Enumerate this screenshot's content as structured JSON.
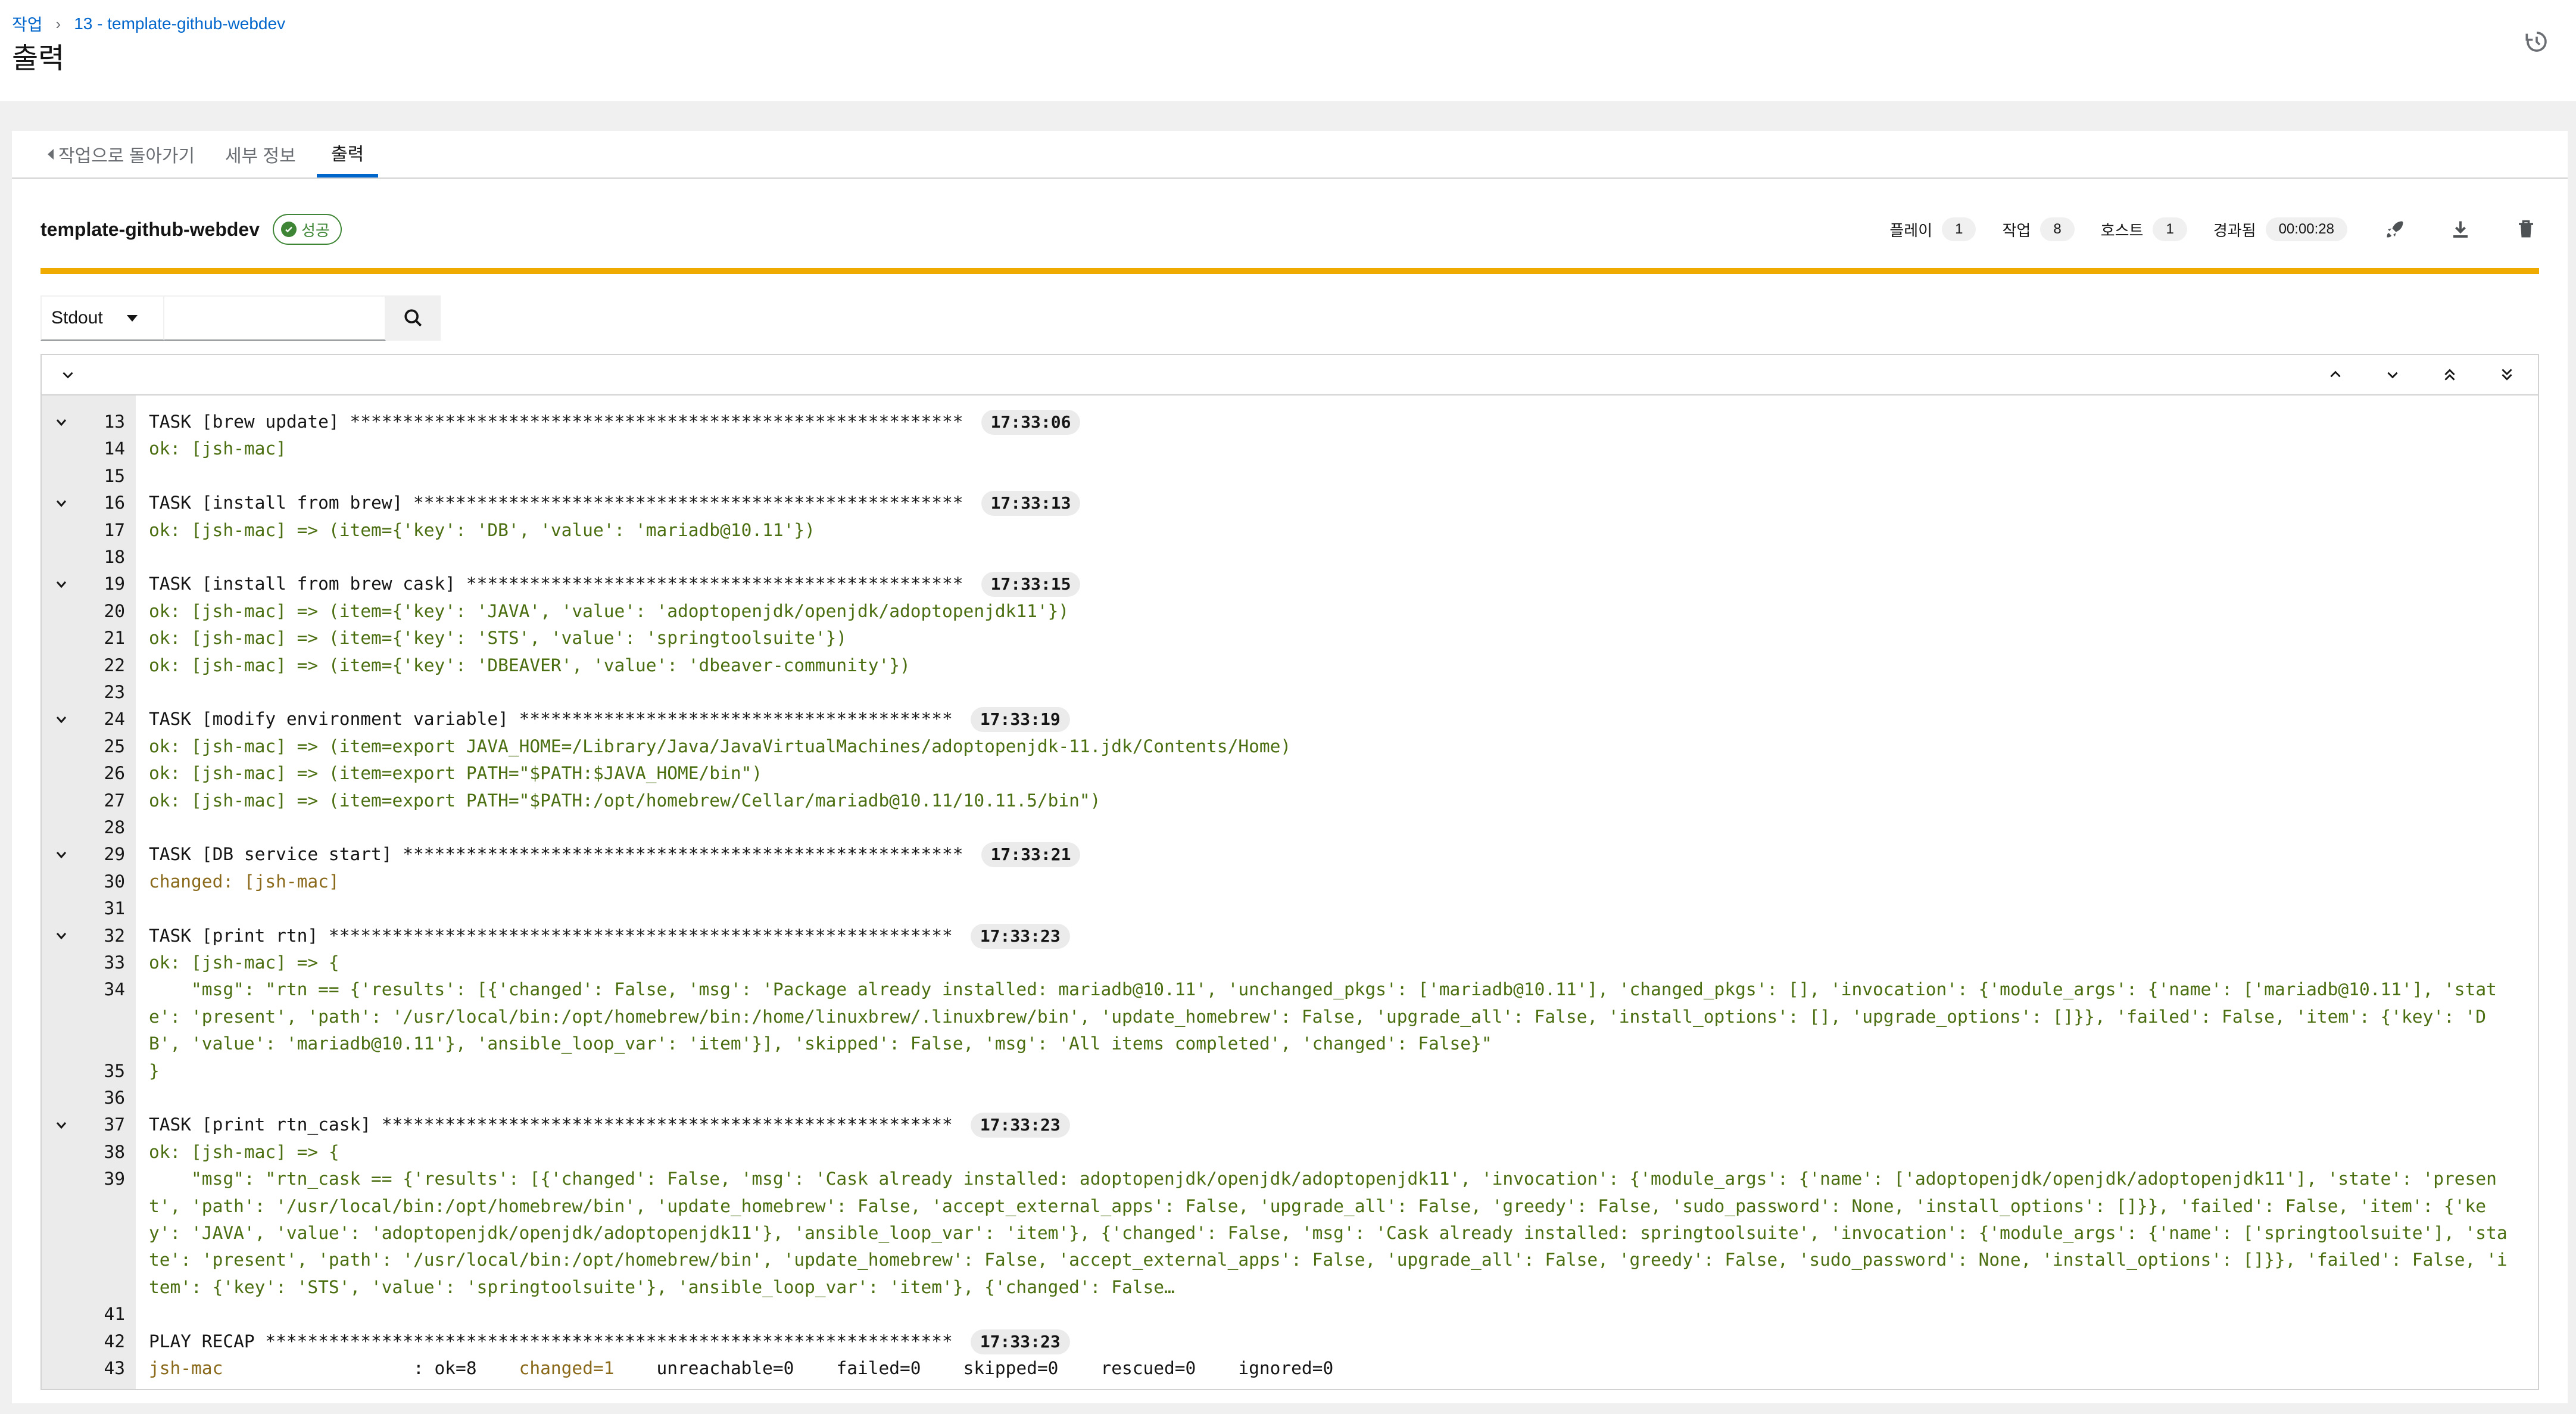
{
  "header": {
    "breadcrumb": [
      "작업",
      "13 - template-github-webdev"
    ],
    "breadcrumb_sep": "›",
    "title": "출력"
  },
  "tabs": [
    {
      "label": "작업으로 돌아가기"
    },
    {
      "label": "세부 정보"
    },
    {
      "label": "출력"
    }
  ],
  "job": {
    "name": "template-github-webdev",
    "status": "성공",
    "stats": [
      {
        "label": "플레이",
        "value": "1"
      },
      {
        "label": "작업",
        "value": "8"
      },
      {
        "label": "호스트",
        "value": "1"
      },
      {
        "label": "경과됨",
        "value": "00:00:28"
      }
    ]
  },
  "search": {
    "select_value": "Stdout",
    "placeholder": ""
  },
  "colors": {
    "accent": "#0066cc",
    "success": "#3e8635",
    "progress": "#f0ab00",
    "ok_text": "#4b6e10",
    "changed_text": "#8a6a1a"
  },
  "output": {
    "lines": [
      {
        "num": "13",
        "toggle": true,
        "text": "TASK [brew update] **********************************************************",
        "ts": "17:33:06",
        "style": "plain"
      },
      {
        "num": "14",
        "text": "ok: [jsh-mac]",
        "style": "ok"
      },
      {
        "num": "15",
        "text": "",
        "style": "plain"
      },
      {
        "num": "16",
        "toggle": true,
        "text": "TASK [install from brew] ****************************************************",
        "ts": "17:33:13",
        "style": "plain"
      },
      {
        "num": "17",
        "text": "ok: [jsh-mac] => (item={'key': 'DB', 'value': 'mariadb@10.11'})",
        "style": "ok"
      },
      {
        "num": "18",
        "text": "",
        "style": "plain"
      },
      {
        "num": "19",
        "toggle": true,
        "text": "TASK [install from brew cask] ***********************************************",
        "ts": "17:33:15",
        "style": "plain"
      },
      {
        "num": "20",
        "text": "ok: [jsh-mac] => (item={'key': 'JAVA', 'value': 'adoptopenjdk/openjdk/adoptopenjdk11'})",
        "style": "ok"
      },
      {
        "num": "21",
        "text": "ok: [jsh-mac] => (item={'key': 'STS', 'value': 'springtoolsuite'})",
        "style": "ok"
      },
      {
        "num": "22",
        "text": "ok: [jsh-mac] => (item={'key': 'DBEAVER', 'value': 'dbeaver-community'})",
        "style": "ok"
      },
      {
        "num": "23",
        "text": "",
        "style": "plain"
      },
      {
        "num": "24",
        "toggle": true,
        "text": "TASK [modify environment variable] *****************************************",
        "ts": "17:33:19",
        "style": "plain"
      },
      {
        "num": "25",
        "text": "ok: [jsh-mac] => (item=export JAVA_HOME=/Library/Java/JavaVirtualMachines/adoptopenjdk-11.jdk/Contents/Home)",
        "style": "ok"
      },
      {
        "num": "26",
        "text": "ok: [jsh-mac] => (item=export PATH=\"$PATH:$JAVA_HOME/bin\")",
        "style": "ok"
      },
      {
        "num": "27",
        "text": "ok: [jsh-mac] => (item=export PATH=\"$PATH:/opt/homebrew/Cellar/mariadb@10.11/10.11.5/bin\")",
        "style": "ok"
      },
      {
        "num": "28",
        "text": "",
        "style": "plain"
      },
      {
        "num": "29",
        "toggle": true,
        "text": "TASK [DB service start] *****************************************************",
        "ts": "17:33:21",
        "style": "plain"
      },
      {
        "num": "30",
        "text": "changed: [jsh-mac]",
        "style": "changed"
      },
      {
        "num": "31",
        "text": "",
        "style": "plain"
      },
      {
        "num": "32",
        "toggle": true,
        "text": "TASK [print rtn] ***********************************************************",
        "ts": "17:33:23",
        "style": "plain"
      },
      {
        "num": "33",
        "text": "ok: [jsh-mac] => {",
        "style": "ok"
      },
      {
        "num": "34",
        "rows": 3,
        "text": "    \"msg\": \"rtn == {'results': [{'changed': False, 'msg': 'Package already installed: mariadb@10.11', 'unchanged_pkgs': ['mariadb@10.11'], 'changed_pkgs': [], 'invocation': {'module_args': {'name': ['mariadb@10.11'], 'state': 'present', 'path': '/usr/local/bin:/opt/homebrew/bin:/home/linuxbrew/.linuxbrew/bin', 'update_homebrew': False, 'upgrade_all': False, 'install_options': [], 'upgrade_options': []}}, 'failed': False, 'item': {'key': 'DB', 'value': 'mariadb@10.11'}, 'ansible_loop_var': 'item'}], 'skipped': False, 'msg': 'All items completed', 'changed': False}\"",
        "style": "ok"
      },
      {
        "num": "35",
        "text": "}",
        "style": "ok"
      },
      {
        "num": "36",
        "text": "",
        "style": "plain"
      },
      {
        "num": "37",
        "toggle": true,
        "text": "TASK [print rtn_cask] ******************************************************",
        "ts": "17:33:23",
        "style": "plain"
      },
      {
        "num": "38",
        "text": "ok: [jsh-mac] => {",
        "style": "ok"
      },
      {
        "num": "39",
        "rows": 5,
        "text": "    \"msg\": \"rtn_cask == {'results': [{'changed': False, 'msg': 'Cask already installed: adoptopenjdk/openjdk/adoptopenjdk11', 'invocation': {'module_args': {'name': ['adoptopenjdk/openjdk/adoptopenjdk11'], 'state': 'present', 'path': '/usr/local/bin:/opt/homebrew/bin', 'update_homebrew': False, 'accept_external_apps': False, 'upgrade_all': False, 'greedy': False, 'sudo_password': None, 'install_options': []}}, 'failed': False, 'item': {'key': 'JAVA', 'value': 'adoptopenjdk/openjdk/adoptopenjdk11'}, 'ansible_loop_var': 'item'}, {'changed': False, 'msg': 'Cask already installed: springtoolsuite', 'invocation': {'module_args': {'name': ['springtoolsuite'], 'state': 'present', 'path': '/usr/local/bin:/opt/homebrew/bin', 'update_homebrew': False, 'accept_external_apps': False, 'upgrade_all': False, 'greedy': False, 'sudo_password': None, 'install_options': []}}, 'failed': False, 'item': {'key': 'STS', 'value': 'springtoolsuite'}, 'ansible_loop_var': 'item'}, {'changed': False…",
        "style": "ok"
      },
      {
        "num": "41",
        "text": "",
        "style": "plain"
      },
      {
        "num": "42",
        "text": "PLAY RECAP *****************************************************************",
        "ts": "17:33:23",
        "style": "plain"
      },
      {
        "num": "43",
        "recap": true,
        "host": "jsh-mac",
        "text": "                  : ok=8    ",
        "changed": "changed=1",
        "rest": "    unreachable=0    failed=0    skipped=0    rescued=0    ignored=0",
        "style": "changed"
      }
    ]
  }
}
